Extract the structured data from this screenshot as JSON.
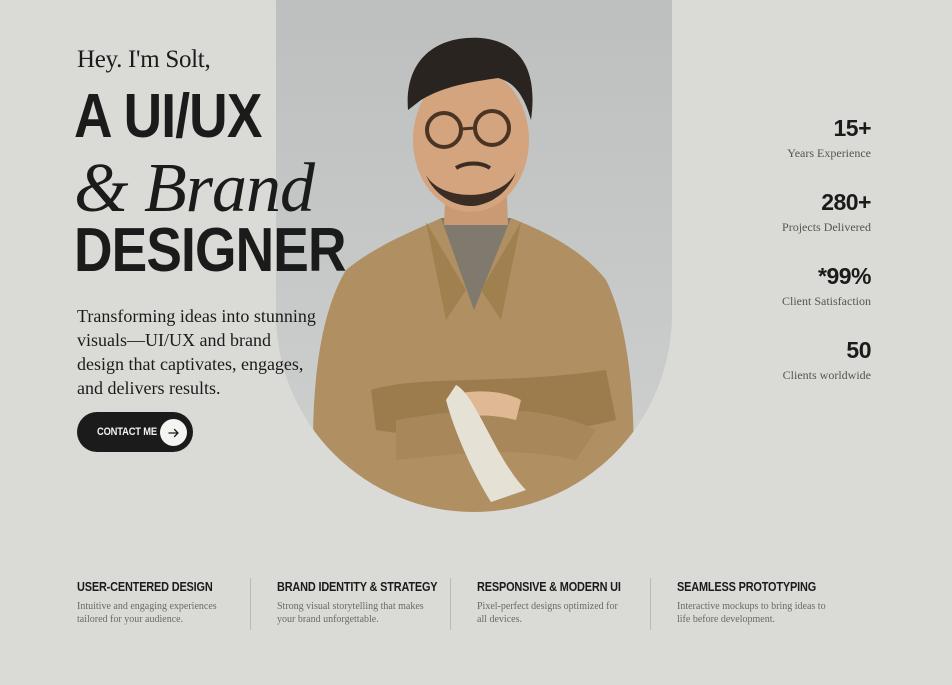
{
  "hero": {
    "greeting": "Hey. I'm Solt,",
    "headline_line1": "A UI/UX",
    "headline_line2": "& Brand",
    "headline_line3": "DESIGNER",
    "tagline": "Transforming ideas into stunning visuals—UI/UX and brand design that captivates, engages, and delivers results.",
    "cta_label": "CONTACT ME",
    "cta_icon": "arrow-right-icon",
    "portrait": "man-in-jacket-arms-crossed"
  },
  "stats": [
    {
      "value": "15+",
      "label": "Years Experience"
    },
    {
      "value": "280+",
      "label": "Projects Delivered"
    },
    {
      "value": "*99%",
      "label": "Client Satisfaction"
    },
    {
      "value": "50",
      "label": "Clients worldwide"
    }
  ],
  "features": [
    {
      "title": "USER-CENTERED DESIGN",
      "desc": "Intuitive and engaging experiences tailored for your audience."
    },
    {
      "title": "BRAND IDENTITY & STRATEGY",
      "desc": "Strong visual storytelling that makes your brand unforgettable."
    },
    {
      "title": "RESPONSIVE & MODERN UI",
      "desc": "Pixel-perfect designs optimized for all devices."
    },
    {
      "title": "SEAMLESS PROTOTYPING",
      "desc": "Interactive mockups to bring ideas to life before development."
    }
  ],
  "colors": {
    "background": "#dadbd6",
    "dark": "#1b1b1b",
    "jacket": "#b08f62"
  }
}
